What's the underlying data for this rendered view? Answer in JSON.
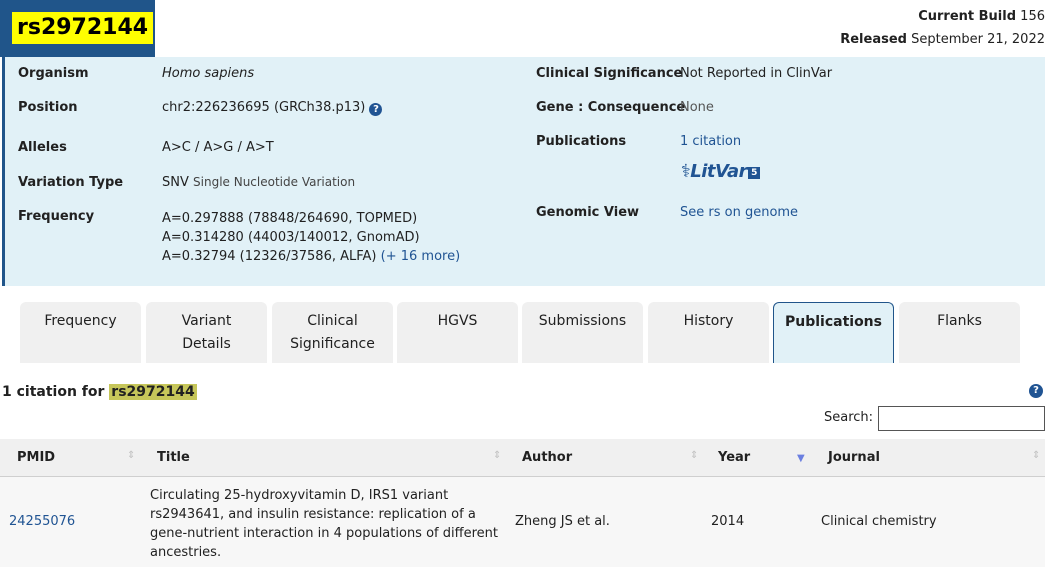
{
  "header": {
    "rsid": "rs2972144",
    "build_label": "Current Build",
    "build_value": "156",
    "released_label": "Released",
    "released_value": "September 21, 2022"
  },
  "summary": {
    "organism_label": "Organism",
    "organism_value": "Homo sapiens",
    "position_label": "Position",
    "position_value": "chr2:226236695 (GRCh38.p13)",
    "alleles_label": "Alleles",
    "alleles_value": "A>C / A>G / A>T",
    "variation_label": "Variation Type",
    "variation_value": "SNV",
    "variation_sub": "Single Nucleotide Variation",
    "frequency_label": "Frequency",
    "frequency_lines": [
      "A=0.297888 (78848/264690, TOPMED)",
      "A=0.314280 (44003/140012, GnomAD)",
      "A=0.32794 (12326/37586, ALFA)"
    ],
    "frequency_more": "(+ 16 more)",
    "clinsig_label": "Clinical Significance",
    "clinsig_value": "Not Reported in ClinVar",
    "gene_label": "Gene : Consequence",
    "gene_value": "None",
    "pubs_label": "Publications",
    "pubs_value": "1 citation",
    "litvar_text": "LitVar",
    "litvar_num": "5",
    "genomic_label": "Genomic View",
    "genomic_value": "See rs on genome"
  },
  "tabs": [
    {
      "label": "Frequency"
    },
    {
      "label": "Variant Details"
    },
    {
      "label": "Clinical Significance"
    },
    {
      "label": "HGVS"
    },
    {
      "label": "Submissions"
    },
    {
      "label": "History"
    },
    {
      "label": "Publications"
    },
    {
      "label": "Flanks"
    }
  ],
  "citations": {
    "heading_prefix": "1 citation for",
    "heading_rsid": "rs2972144",
    "search_label": "Search:",
    "search_value": ""
  },
  "table": {
    "columns": [
      "PMID",
      "Title",
      "Author",
      "Year",
      "Journal"
    ],
    "rows": [
      {
        "pmid": "24255076",
        "title": "Circulating 25-hydroxyvitamin D, IRS1 variant rs2943641, and insulin resistance: replication of a gene-nutrient interaction in 4 populations of different ancestries.",
        "author": "Zheng JS et al.",
        "year": "2014",
        "journal": "Clinical chemistry"
      }
    ]
  },
  "colors": {
    "brand": "#20558a",
    "panel": "#e1f1f7",
    "highlight": "#ffff00",
    "link": "#205493"
  }
}
